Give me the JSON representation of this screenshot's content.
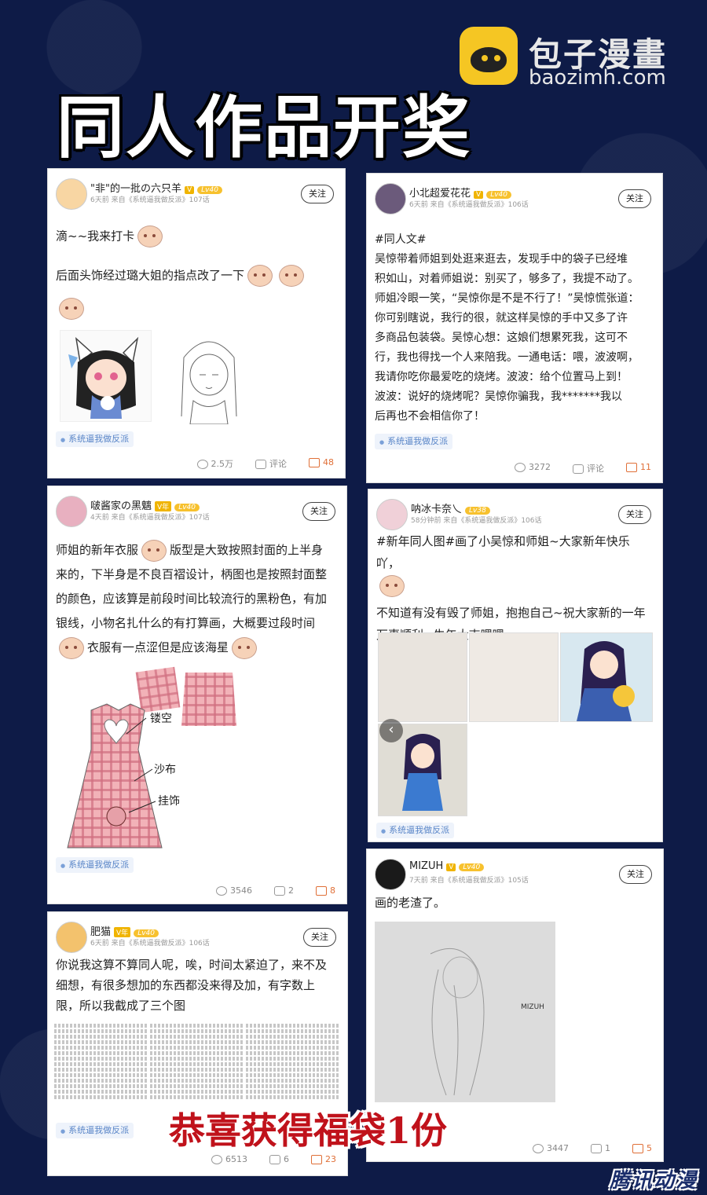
{
  "brand": {
    "name": "包子漫畫",
    "url": "baozimh.com"
  },
  "title": "同人作品开奖",
  "follow_label": "关注",
  "tag_label": "系统逼我做反派",
  "comment_label": "评论",
  "posts": [
    {
      "user": "\"非\"的一批の六只羊",
      "vip": "V",
      "level": "Lv40",
      "meta": "6天前  来自《系统逼我做反派》107话",
      "lines": [
        "滴~~我来打卡",
        "后面头饰经过璐大姐的指点改了一下"
      ],
      "views": "2.5万",
      "comments": "评论",
      "likes": "48"
    },
    {
      "user": "小北超爱花花",
      "vip": "V",
      "level": "Lv40",
      "meta": "6天前  来自《系统逼我做反派》106话",
      "lines": [
        "#同人文#",
        "吴惊带着师姐到处逛来逛去，发现手中的袋子已经堆",
        "积如山，对着师姐说：别买了，够多了，我提不动了。",
        "师姐冷眼一笑，“吴惊你是不是不行了！”吴惊慌张道：",
        "你可别瞎说，我行的很，就这样吴惊的手中又多了许",
        "多商品包装袋。吴惊心想：这娘们想累死我，这可不",
        "行，我也得找一个人来陪我。一通电话：喂，波波啊，",
        "我请你吃你最爱吃的烧烤。波波：给个位置马上到！",
        "波波：说好的烧烤呢？吴惊你骗我，我*******我以",
        "后再也不会相信你了！"
      ],
      "views": "3272",
      "comments": "评论",
      "likes": "11"
    },
    {
      "user": "啵酱家の黑魑",
      "vip": "V年",
      "level": "Lv40",
      "meta": "4天前  来自《系统逼我做反派》107话",
      "lines": [
        "师姐的新年衣服",
        "版型是大致按照封面的上半身",
        "来的，下半身是不良百褶设计，柄图也是按照封面整",
        "的颜色，应该算是前段时间比较流行的黑粉色，有加",
        "银线，小物名扎什么的有打算画，大概要过段时间",
        "衣服有一点涩但是应该海星"
      ],
      "sketch_notes": [
        "镂空",
        "沙布",
        "挂饰"
      ],
      "views": "3546",
      "comments": "2",
      "likes": "8"
    },
    {
      "user": "呐冰卡奈乀",
      "vip": "",
      "level": "Lv38",
      "meta": "58分钟前  来自《系统逼我做反派》106话",
      "lines": [
        "#新年同人图#画了小吴惊和师姐~大家新年快乐吖，",
        "不知道有没有毁了师姐，抱抱自己~祝大家新的一年",
        "万事顺利~牛年大吉嘿嘿~"
      ],
      "views": "",
      "comments": "",
      "likes": ""
    },
    {
      "user": "MIZUH",
      "vip": "V",
      "level": "Lv40",
      "meta": "7天前  来自《系统逼我做反派》105话",
      "lines": [
        "画的老渣了。"
      ],
      "signature": "MIZUH",
      "views": "3447",
      "comments": "1",
      "likes": "5"
    },
    {
      "user": "肥猫",
      "vip": "V年",
      "level": "Lv40",
      "meta": "6天前  来自《系统逼我做反派》106话",
      "lines": [
        "你说我这算不算同人呢，唉，时间太紧迫了，来不及",
        "细想，有很多想加的东西都没来得及加，有字数上",
        "限，所以我截成了三个图"
      ],
      "views": "6513",
      "comments": "6",
      "likes": "23"
    }
  ],
  "prize": "恭喜获得福袋1份",
  "watermark": "腾讯动漫"
}
